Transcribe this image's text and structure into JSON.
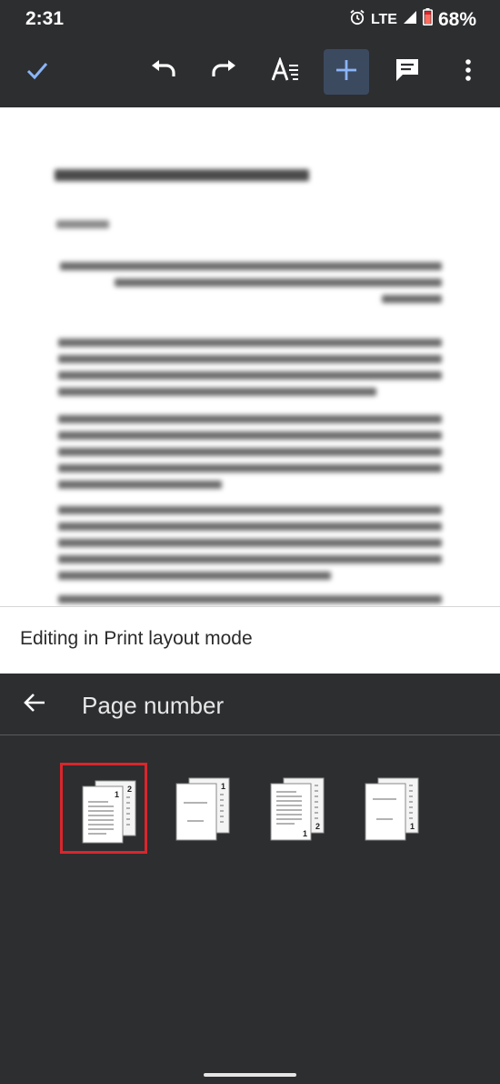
{
  "status_bar": {
    "time": "2:31",
    "network": "LTE",
    "battery": "68%",
    "icons": [
      "alarm-icon",
      "signal-icon",
      "battery-icon"
    ]
  },
  "toolbar": {
    "buttons": [
      "done-check-icon",
      "undo-icon",
      "redo-icon",
      "text-format-icon",
      "insert-plus-icon",
      "comment-icon",
      "more-vert-icon"
    ],
    "active_button": "insert-plus-icon",
    "accent_color": "#8ab4f8"
  },
  "banner": {
    "text": "Editing in Print layout mode"
  },
  "page_number_panel": {
    "title": "Page number",
    "options": [
      {
        "name": "top-right-all-pages",
        "labels": [
          "1",
          "2"
        ],
        "selected": true
      },
      {
        "name": "top-right-skip-first",
        "labels": [
          "1"
        ],
        "selected": false
      },
      {
        "name": "bottom-right-all-pages",
        "labels": [
          "1",
          "2"
        ],
        "selected": false
      },
      {
        "name": "bottom-right-skip-first",
        "labels": [
          "1"
        ],
        "selected": false
      }
    ],
    "selected_color": "#d9262c"
  }
}
